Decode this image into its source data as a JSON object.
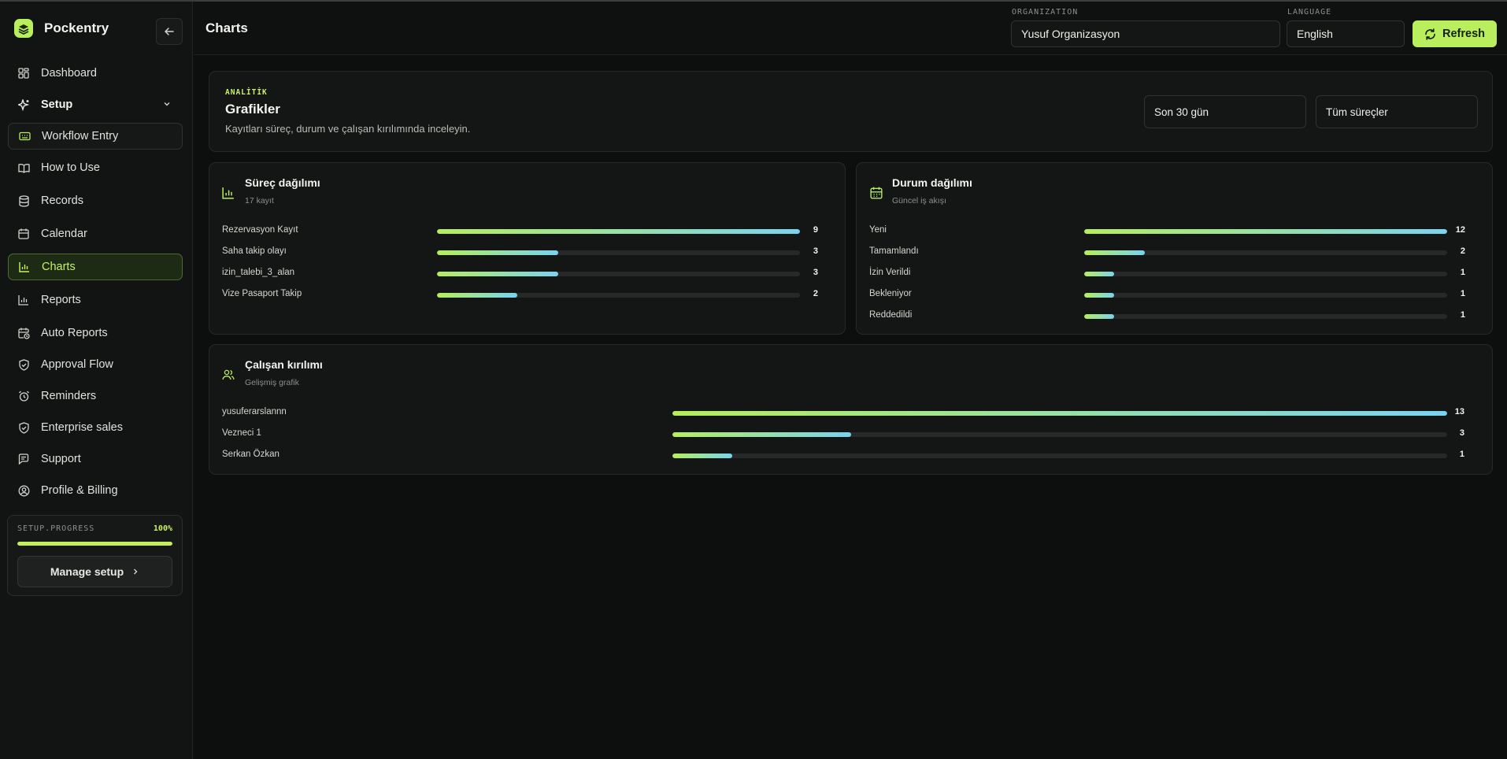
{
  "app": {
    "name": "Pockentry"
  },
  "sidebar": {
    "items": [
      {
        "label": "Dashboard",
        "icon": "grid-icon"
      },
      {
        "label": "Setup",
        "icon": "sparkle-icon"
      },
      {
        "label": "Workflow Entry",
        "icon": "keyboard-icon"
      },
      {
        "label": "How to Use",
        "icon": "book-icon"
      },
      {
        "label": "Records",
        "icon": "database-icon"
      },
      {
        "label": "Calendar",
        "icon": "calendar-icon"
      },
      {
        "label": "Charts",
        "icon": "bar-chart-icon"
      },
      {
        "label": "Reports",
        "icon": "bar-chart-icon"
      },
      {
        "label": "Auto Reports",
        "icon": "calendar-clock-icon"
      },
      {
        "label": "Approval Flow",
        "icon": "shield-check-icon"
      },
      {
        "label": "Reminders",
        "icon": "alarm-icon"
      },
      {
        "label": "Enterprise sales",
        "icon": "shield-icon"
      },
      {
        "label": "Support",
        "icon": "message-icon"
      },
      {
        "label": "Profile & Billing",
        "icon": "user-circle-icon"
      }
    ],
    "setup_progress": {
      "label": "SETUP.PROGRESS",
      "value_text": "100%",
      "value": 1.0,
      "button": "Manage setup"
    }
  },
  "header": {
    "title": "Charts",
    "organization": {
      "label": "ORGANIZATION",
      "value": "Yusuf Organizasyon"
    },
    "language": {
      "label": "LANGUAGE",
      "value": "English"
    },
    "refresh_label": "Refresh"
  },
  "analytics": {
    "eyebrow": "ANALİTİK",
    "title": "Grafikler",
    "description": "Kayıtları süreç, durum ve çalışan kırılımında inceleyin.",
    "filters": {
      "period": "Son 30 gün",
      "process": "Tüm süreçler"
    }
  },
  "colors": {
    "accent": "#b9ee5c",
    "bar_gradient_start": "#b6ee5a",
    "bar_gradient_end": "#79d3f0"
  },
  "chart_data": [
    {
      "type": "bar",
      "title": "Süreç dağılımı",
      "subtitle": "17 kayıt",
      "categories": [
        "Rezervasyon Kayıt",
        "Saha takip olayı",
        "izin_talebi_3_alan",
        "Vize Pasaport Takip"
      ],
      "values": [
        9,
        3,
        3,
        2
      ],
      "value_labels": [
        "9",
        "3",
        "3",
        "2"
      ]
    },
    {
      "type": "bar",
      "title": "Durum dağılımı",
      "subtitle": "Güncel iş akışı",
      "categories": [
        "Yeni",
        "Tamamlandı",
        "İzin Verildi",
        "Bekleniyor",
        "Reddedildi"
      ],
      "values": [
        12,
        2,
        1,
        1,
        1
      ],
      "value_labels": [
        "12",
        "2",
        "1",
        "1",
        "1"
      ]
    },
    {
      "type": "bar",
      "title": "Çalışan kırılımı",
      "subtitle": "Gelişmiş grafik",
      "categories": [
        "yusuferarslannn",
        "Vezneci 1",
        "Serkan Özkan"
      ],
      "values": [
        13,
        3,
        1
      ],
      "value_labels": [
        "13",
        "3",
        "1"
      ]
    }
  ]
}
